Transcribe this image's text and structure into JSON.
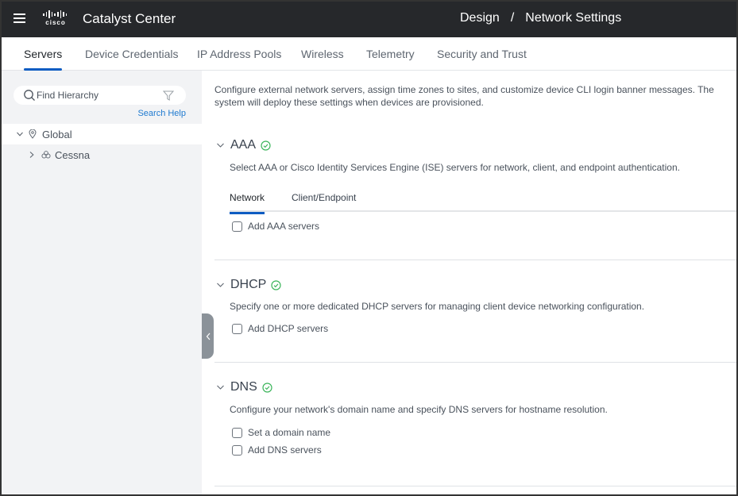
{
  "header": {
    "app_title": "Catalyst Center",
    "logo_text": "cisco",
    "breadcrumb": [
      "Design",
      "/",
      "Network Settings"
    ]
  },
  "tabs": [
    {
      "label": "Servers",
      "active": true
    },
    {
      "label": "Device Credentials",
      "active": false
    },
    {
      "label": "IP Address Pools",
      "active": false
    },
    {
      "label": "Wireless",
      "active": false
    },
    {
      "label": "Telemetry",
      "active": false
    },
    {
      "label": "Security and Trust",
      "active": false
    }
  ],
  "sidebar": {
    "search": {
      "placeholder": "Find Hierarchy",
      "value": ""
    },
    "search_help": "Search Help",
    "tree": [
      {
        "label": "Global",
        "icon": "location-pin-icon",
        "expanded": true
      },
      {
        "label": "Cessna",
        "icon": "building-group-icon",
        "expanded": false
      }
    ]
  },
  "main": {
    "intro": "Configure external network servers, assign time zones to sites, and customize device CLI login banner messages. The system will deploy these settings when devices are provisioned.",
    "sections": [
      {
        "title": "AAA",
        "status": "ok",
        "description": "Select AAA or Cisco Identity Services Engine (ISE) servers for network, client, and endpoint authentication.",
        "subtabs": [
          {
            "label": "Network",
            "active": true
          },
          {
            "label": "Client/Endpoint",
            "active": false
          }
        ],
        "checkboxes": [
          {
            "label": "Add AAA servers",
            "checked": false
          }
        ]
      },
      {
        "title": "DHCP",
        "status": "ok",
        "description": "Specify one or more dedicated DHCP servers for managing client device networking configuration.",
        "checkboxes": [
          {
            "label": "Add DHCP servers",
            "checked": false
          }
        ]
      },
      {
        "title": "DNS",
        "status": "ok",
        "description": "Configure your network's domain name and specify DNS servers for hostname resolution.",
        "checkboxes": [
          {
            "label": "Set a domain name",
            "checked": false
          },
          {
            "label": "Add DNS servers",
            "checked": false
          }
        ]
      }
    ]
  },
  "colors": {
    "header_bg": "#26282b",
    "accent": "#0d5cc2",
    "link": "#1f7ad0",
    "status_ok": "#3cb55b"
  }
}
